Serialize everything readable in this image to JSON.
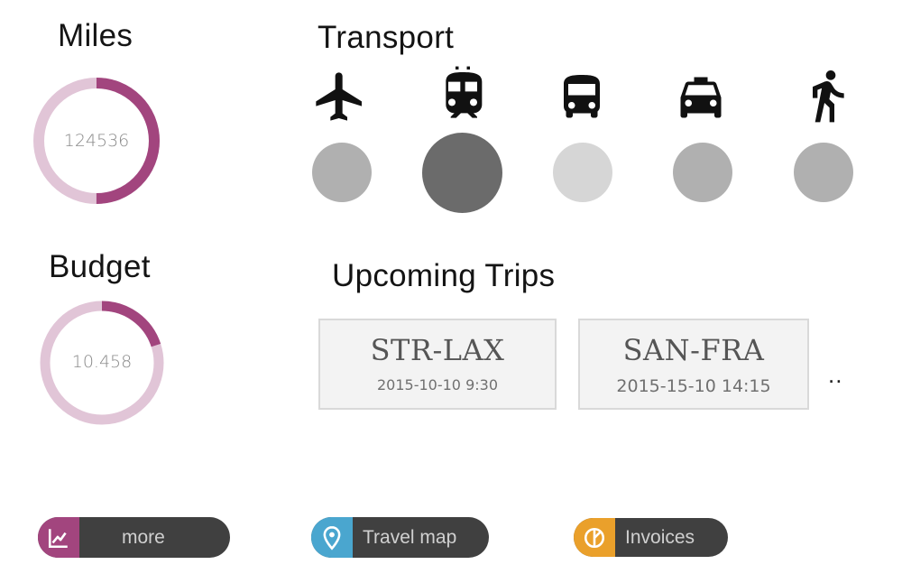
{
  "miles": {
    "title": "Miles",
    "value": "124536",
    "fraction": 0.5
  },
  "budget": {
    "title": "Budget",
    "value": "10.458",
    "fraction": 0.2
  },
  "transport": {
    "title": "Transport",
    "modes": [
      {
        "icon": "airplane-icon",
        "level": "medium"
      },
      {
        "icon": "train-icon",
        "level": "high",
        "selected": true
      },
      {
        "icon": "bus-icon",
        "level": "low"
      },
      {
        "icon": "taxi-icon",
        "level": "medium"
      },
      {
        "icon": "walking-icon",
        "level": "medium"
      }
    ]
  },
  "trips": {
    "title": "Upcoming Trips",
    "items": [
      {
        "route": "STR-LAX",
        "datetime": "2015-10-10 9:30"
      },
      {
        "route": "SAN-FRA",
        "datetime": "2015-15-10 14:15"
      }
    ],
    "more": ".."
  },
  "actions": [
    {
      "label": "more",
      "icon": "chart-icon",
      "color": "#a2457e"
    },
    {
      "label": "Travel map",
      "icon": "map-pin-icon",
      "color": "#4aa6cf"
    },
    {
      "label": "Invoices",
      "icon": "pie-chart-icon",
      "color": "#eaa02b"
    }
  ],
  "colors": {
    "ring_accent": "#a2457e",
    "ring_track": "#e1c5d7",
    "circle_light": "#d6d6d6",
    "circle_medium": "#b0b0b0",
    "circle_dark": "#6b6b6b"
  }
}
